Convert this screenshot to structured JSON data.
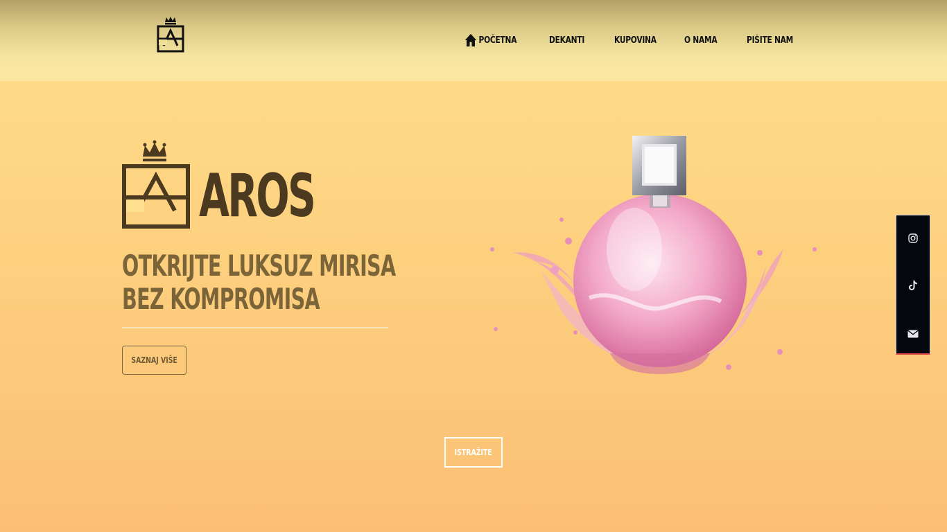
{
  "header": {
    "nav": [
      {
        "label": "POČETNA",
        "icon": "home-icon"
      },
      {
        "label": "DEKANTI"
      },
      {
        "label": "KUPOVINA"
      },
      {
        "label": "O NAMA"
      },
      {
        "label": "PIŠITE NAM"
      }
    ]
  },
  "hero": {
    "brand": "AROS",
    "tagline_line1": "OTKRIJTE LUKSUZ MIRISA",
    "tagline_line2": "BEZ KOMPROMISA",
    "cta_label": "SAZNAJ VIŠE",
    "explore_label": "ISTRAŽITE"
  },
  "social": [
    {
      "icon": "instagram-icon"
    },
    {
      "icon": "tiktok-icon"
    },
    {
      "icon": "envelope-icon"
    }
  ],
  "colors": {
    "brand_dark": "#4c3a20",
    "tagline": "#7b6438",
    "social_bg": "#05070f"
  }
}
